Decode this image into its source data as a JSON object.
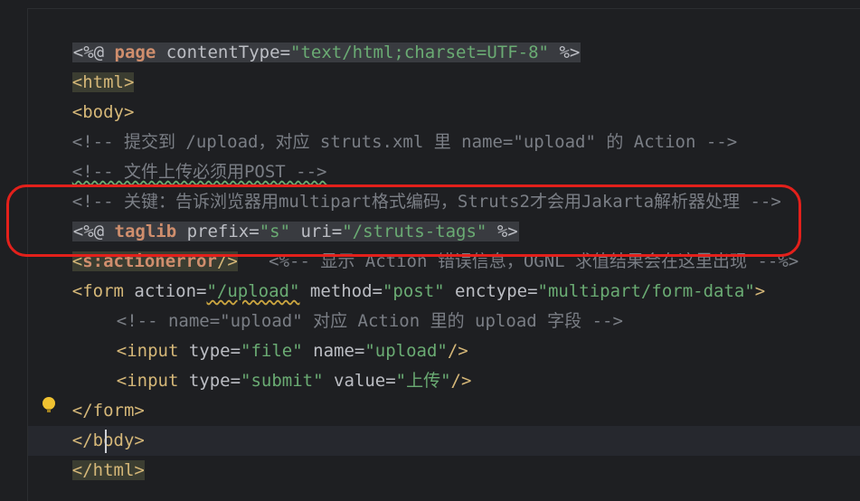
{
  "editor": {
    "lines": [
      {
        "parts": [
          "<%@ ",
          "page",
          " contentType=",
          "\"text/html;charset=UTF-8\"",
          " %>"
        ]
      },
      {
        "parts": [
          "<html>"
        ]
      },
      {
        "parts": [
          "<body>"
        ]
      },
      {
        "parts": [
          "<!-- 提交到 /upload，对应 struts.xml 里 name=\"upload\" 的 Action -->"
        ]
      },
      {
        "parts": [
          "<!-- 文件上传必须用POST -->"
        ]
      },
      {
        "parts": [
          "<!-- 关键：告诉浏览器用multipart格式编码，Struts2才会用Jakarta解析器处理 -->"
        ]
      },
      {
        "parts": [
          "<%@ ",
          "taglib",
          " prefix=",
          "\"s\"",
          " uri=",
          "\"/struts-tags\"",
          " %>"
        ]
      },
      {
        "parts": [
          "<",
          "s:actionerror",
          "/>",
          "   <%-- 显示 Action 错误信息，OGNL 求值结果会在这里出现 --%>"
        ]
      },
      {
        "parts": [
          "<form",
          " action=",
          "\"/upload\"",
          " method=",
          "\"post\"",
          " enctype=",
          "\"multipart/form-data\"",
          ">"
        ]
      },
      {
        "parts": [
          "<!-- name=\"upload\" 对应 Action 里的 upload 字段 -->"
        ]
      },
      {
        "parts": [
          "<input",
          " type=",
          "\"file\"",
          " name=",
          "\"upload\"",
          "/>"
        ]
      },
      {
        "parts": [
          "<input",
          " type=",
          "\"submit\"",
          " value=",
          "\"上传\"",
          "/>"
        ]
      },
      {
        "parts": [
          "</form>"
        ]
      },
      {
        "parts": [
          "</body>"
        ]
      },
      {
        "parts": [
          "</html>"
        ]
      }
    ]
  },
  "colors": {
    "background": "#1e1f22",
    "tag": "#d5b778",
    "string": "#6aab73",
    "keyword": "#cf8e6d",
    "comment": "#7a7e85",
    "annotation_box": "#e3201b",
    "bulb": "#f0c231"
  },
  "icons": {
    "intention": "lightbulb-icon"
  }
}
